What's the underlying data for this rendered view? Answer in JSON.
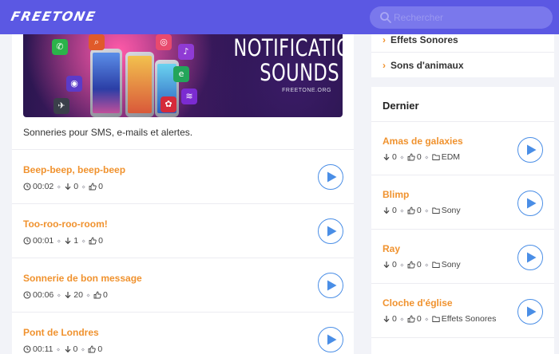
{
  "header": {
    "logo": "FREETONE",
    "search_placeholder": "Rechercher"
  },
  "banner": {
    "title_line1": "NOTIFICATION",
    "title_line2": "SOUNDS",
    "site": "FREETONE.ORG"
  },
  "main": {
    "description": "Sonneries pour SMS, e-mails et alertes.",
    "tracks": [
      {
        "title": "Beep-beep, beep-beep",
        "duration": "00:02",
        "downloads": "0",
        "likes": "0"
      },
      {
        "title": "Too-roo-roo-room!",
        "duration": "00:01",
        "downloads": "1",
        "likes": "0"
      },
      {
        "title": "Sonnerie de bon message",
        "duration": "00:06",
        "downloads": "20",
        "likes": "0"
      },
      {
        "title": "Pont de Londres",
        "duration": "00:11",
        "downloads": "0",
        "likes": "0"
      }
    ]
  },
  "sidebar": {
    "categories": [
      "Effets Sonores",
      "Sons d'animaux"
    ],
    "latest_heading": "Dernier",
    "latest": [
      {
        "title": "Amas de galaxies",
        "downloads": "0",
        "likes": "0",
        "category": "EDM"
      },
      {
        "title": "Blimp",
        "downloads": "0",
        "likes": "0",
        "category": "Sony"
      },
      {
        "title": "Ray",
        "downloads": "0",
        "likes": "0",
        "category": "Sony"
      },
      {
        "title": "Cloche d'église",
        "downloads": "0",
        "likes": "0",
        "category": "Effets Sonores"
      }
    ]
  },
  "colors": {
    "header_bg": "#5b58e3",
    "accent_orange": "#f0922e",
    "play_blue": "#4a8ee6"
  }
}
